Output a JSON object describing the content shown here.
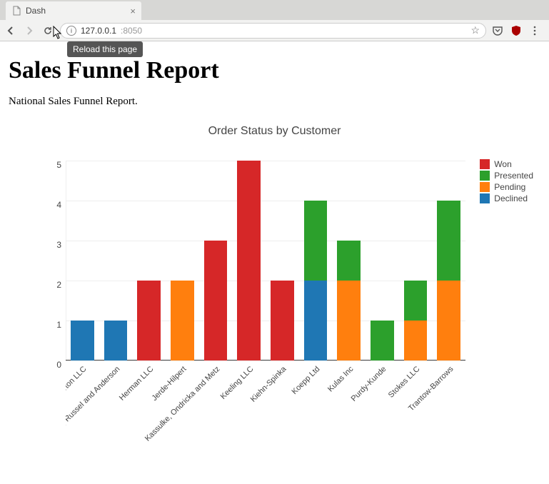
{
  "browser": {
    "tab_title": "Dash",
    "url_host": "127.0.0.1",
    "url_port": ":8050",
    "tooltip": "Reload this page"
  },
  "page": {
    "heading": "Sales Funnel Report",
    "subtitle": "National Sales Funnel Report."
  },
  "colors": {
    "Won": "#d62728",
    "Presented": "#2ca02c",
    "Pending": "#ff7f0e",
    "Declined": "#1f77b4"
  },
  "legend": [
    "Won",
    "Presented",
    "Pending",
    "Declined"
  ],
  "chart_data": {
    "type": "bar",
    "stacked": true,
    "title": "Order Status by Customer",
    "xlabel": "",
    "ylabel": "",
    "ylim": [
      0,
      5
    ],
    "yticks": [
      0,
      1,
      2,
      3,
      4,
      5
    ],
    "categories": [
      "Barton LLC",
      "Fritsch, Russel and Anderson",
      "Herman LLC",
      "Jerde-Hilpert",
      "Kassulke, Ondricka and Metz",
      "Keeling LLC",
      "Kiehn-Spinka",
      "Koepp Ltd",
      "Kulas Inc",
      "Purdy-Kunde",
      "Stokes LLC",
      "Trantow-Barrows"
    ],
    "series": [
      {
        "name": "Declined",
        "values": [
          1,
          1,
          0,
          0,
          0,
          0,
          0,
          2,
          0,
          0,
          0,
          0
        ]
      },
      {
        "name": "Pending",
        "values": [
          0,
          0,
          0,
          2,
          0,
          0,
          0,
          0,
          2,
          0,
          1,
          2
        ]
      },
      {
        "name": "Presented",
        "values": [
          0,
          0,
          0,
          0,
          0,
          0,
          0,
          2,
          1,
          1,
          1,
          2
        ]
      },
      {
        "name": "Won",
        "values": [
          0,
          0,
          2,
          0,
          3,
          5,
          2,
          0,
          0,
          0,
          0,
          0
        ]
      }
    ]
  }
}
